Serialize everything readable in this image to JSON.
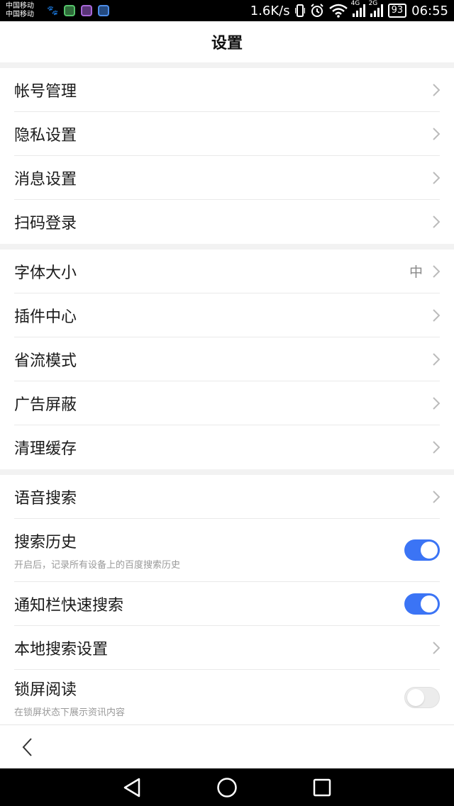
{
  "status_bar": {
    "carrier1": "中国移动",
    "carrier2": "中国移动",
    "speed": "1.6K/s",
    "net1": "4G",
    "net2": "2G",
    "battery": "93",
    "time": "06:55",
    "app_icons": [
      "paw-icon",
      "green-app-icon",
      "purple-app-icon",
      "blue-app-icon"
    ]
  },
  "header": {
    "title": "设置"
  },
  "section1": [
    {
      "label": "帐号管理"
    },
    {
      "label": "隐私设置"
    },
    {
      "label": "消息设置"
    },
    {
      "label": "扫码登录"
    }
  ],
  "section2": [
    {
      "label": "字体大小",
      "value": "中"
    },
    {
      "label": "插件中心"
    },
    {
      "label": "省流模式"
    },
    {
      "label": "广告屏蔽"
    },
    {
      "label": "清理缓存"
    }
  ],
  "section3": [
    {
      "label": "语音搜索"
    },
    {
      "label": "搜索历史",
      "sub": "开启后，记录所有设备上的百度搜索历史",
      "toggle": "on"
    },
    {
      "label": "通知栏快速搜索",
      "toggle": "on"
    },
    {
      "label": "本地搜索设置"
    },
    {
      "label": "锁屏阅读",
      "sub": "在锁屏状态下展示资讯内容",
      "toggle": "off"
    }
  ],
  "colors": {
    "accent": "#3b74f5",
    "toggle_off": "#ececec",
    "background": "#f2f2f2"
  }
}
